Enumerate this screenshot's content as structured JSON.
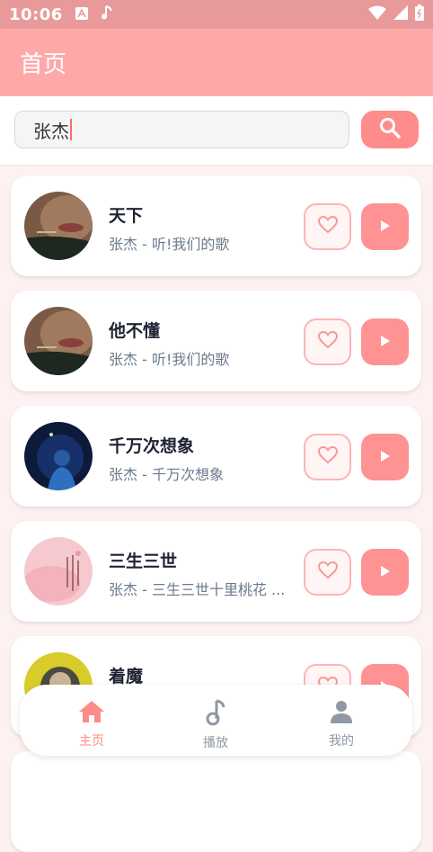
{
  "status_bar": {
    "time": "10:06"
  },
  "app_bar": {
    "title": "首页"
  },
  "search": {
    "value": "张杰"
  },
  "songs": [
    {
      "title": "天下",
      "subtitle": "张杰 - 听!我们的歌"
    },
    {
      "title": "他不懂",
      "subtitle": "张杰 - 听!我们的歌"
    },
    {
      "title": "千万次想象",
      "subtitle": "张杰 - 千万次想象"
    },
    {
      "title": "三生三世",
      "subtitle": "张杰 - 三生三世十里桃花 ..."
    },
    {
      "title": "着魔",
      "subtitle": ""
    }
  ],
  "nav": {
    "home_label": "主页",
    "play_label": "播放",
    "mine_label": "我的"
  },
  "colors": {
    "app_bar": "#fea9a9",
    "status_bar": "#e89a9a",
    "accent": "#ff8c8c",
    "like_border": "#fcb5b5"
  }
}
